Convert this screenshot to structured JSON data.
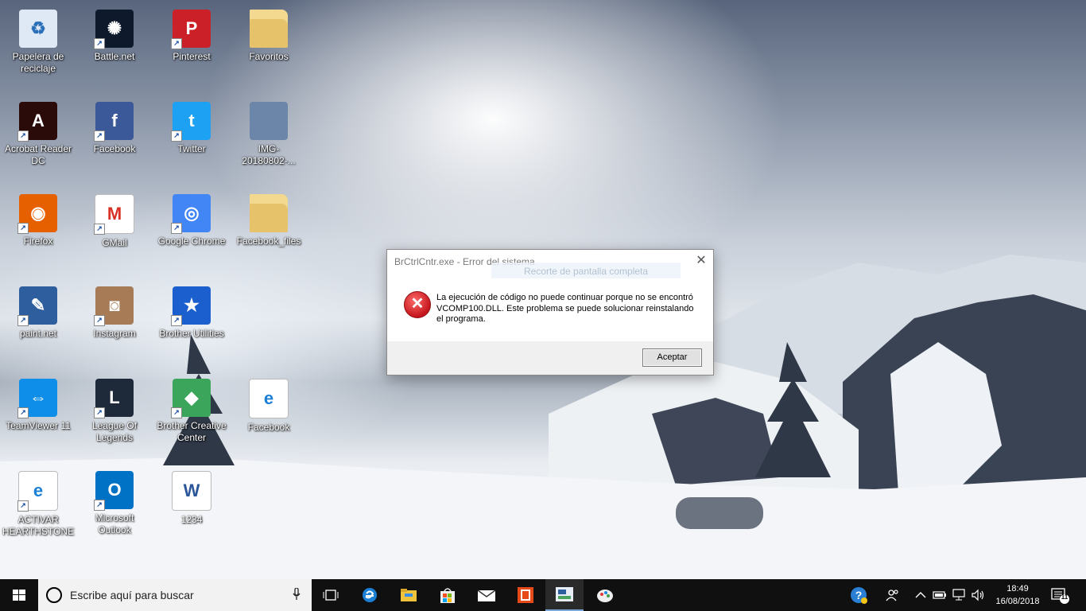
{
  "desktop": {
    "icons": [
      {
        "label": "Papelera de\nreciclaje",
        "icon": "recycle-bin-icon",
        "color": "#dfe9f5"
      },
      {
        "label": "Battle.net",
        "icon": "battlenet-icon",
        "color": "#0e1a2c"
      },
      {
        "label": "Pinterest",
        "icon": "pinterest-icon",
        "color": "#cb2027"
      },
      {
        "label": "Favoritos",
        "icon": "folder-icon",
        "color": "#e6c36a"
      },
      {
        "label": "Acrobat Reader\nDC",
        "icon": "acrobat-icon",
        "color": "#2b0a0a"
      },
      {
        "label": "Facebook",
        "icon": "facebook-icon",
        "color": "#3b5998"
      },
      {
        "label": "Twitter",
        "icon": "twitter-icon",
        "color": "#1da1f2"
      },
      {
        "label": "IMG-20180802-...",
        "icon": "image-thumbnail-icon",
        "color": "#6b86a8"
      },
      {
        "label": "Firefox",
        "icon": "firefox-icon",
        "color": "#e66000"
      },
      {
        "label": "GMail",
        "icon": "gmail-icon",
        "color": "#ffffff"
      },
      {
        "label": "Google Chrome",
        "icon": "chrome-icon",
        "color": "#4285f4"
      },
      {
        "label": "Facebook_files",
        "icon": "folder-icon",
        "color": "#e6c36a"
      },
      {
        "label": "paint.net",
        "icon": "paintnet-icon",
        "color": "#2f5e9e"
      },
      {
        "label": "Instagram",
        "icon": "instagram-icon",
        "color": "#a77b55"
      },
      {
        "label": "Brother Utilities",
        "icon": "brother-utilities-icon",
        "color": "#1b5fcf"
      },
      {
        "label": "TeamViewer 11",
        "icon": "teamviewer-icon",
        "color": "#0e8ee9"
      },
      {
        "label": "League Of\nLegends",
        "icon": "league-of-legends-icon",
        "color": "#1e2a3a"
      },
      {
        "label": "Brother Creative\nCenter",
        "icon": "brother-creative-center-icon",
        "color": "#3aa55b"
      },
      {
        "label": "Facebook",
        "icon": "edge-document-icon",
        "color": "#ffffff"
      },
      {
        "label": "ACTIVAR\nHEARTHSTONE",
        "icon": "edge-pdf-icon",
        "color": "#ffffff"
      },
      {
        "label": "Microsoft\nOutlook",
        "icon": "outlook-icon",
        "color": "#0072c6"
      },
      {
        "label": "1234",
        "icon": "word-document-icon",
        "color": "#ffffff"
      }
    ]
  },
  "dialog": {
    "title": "BrCtrlCntr.exe - Error del sistema",
    "ghost_text": "Recorte de pantalla completa",
    "message": "La ejecución de código no puede continuar porque no se encontró VCOMP100.DLL. Este problema se puede solucionar reinstalando el programa.",
    "ok_label": "Aceptar",
    "close_glyph": "✕",
    "error_glyph": "✕"
  },
  "taskbar": {
    "search_placeholder": "Escribe aquí para buscar",
    "pinned": [
      "task-view-icon",
      "edge-icon",
      "file-explorer-icon",
      "store-icon",
      "mail-icon",
      "office-icon",
      "brother-app-icon",
      "paint-app-icon"
    ],
    "clock": {
      "time": "18:49",
      "date": "16/08/2018"
    },
    "notification_count": "11"
  }
}
